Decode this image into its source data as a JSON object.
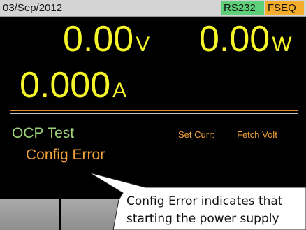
{
  "status_bar": {
    "date": "03/Sep/2012",
    "interface_badge": "RS232",
    "mode_badge": "FSEQ",
    "colors": {
      "bar": "#d4d4d4",
      "interface_badge": "#5fd07a",
      "mode_badge": "#f6ad2c"
    }
  },
  "readouts": {
    "voltage": {
      "value": "0.00",
      "unit": "V"
    },
    "power": {
      "value": "0.00",
      "unit": "W"
    },
    "current": {
      "value": "0.000",
      "unit": "A"
    },
    "color": "#f5f52a"
  },
  "test": {
    "name": "OCP Test",
    "status": "Config Error",
    "set_curr_label": "Set Curr:",
    "fetch_label": "Fetch Volt"
  },
  "softkeys": [
    "",
    ""
  ],
  "callout": {
    "line1": "Config Error indicates that",
    "line2": "starting the power supply"
  }
}
